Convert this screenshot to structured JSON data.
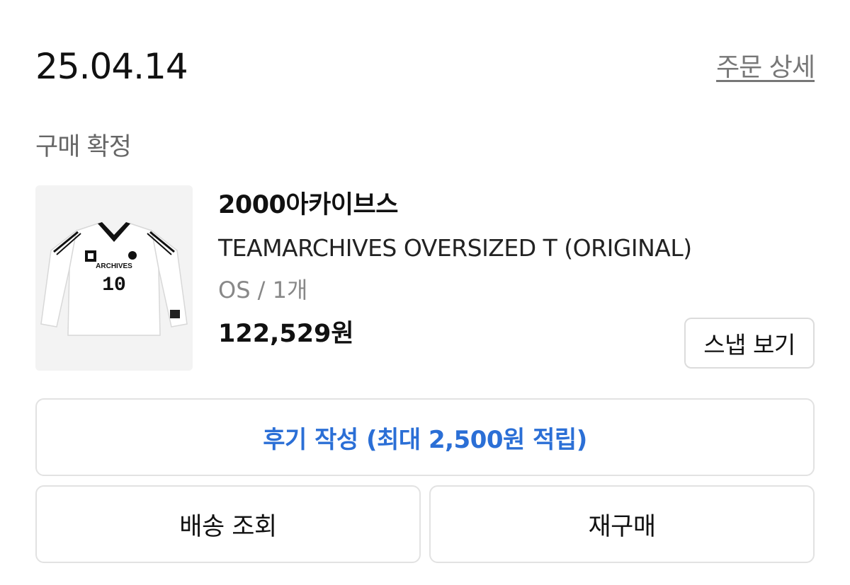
{
  "order": {
    "date": "25.04.14",
    "detail_link": "주문 상세",
    "status": "구매 확정"
  },
  "product": {
    "brand": "2000아카이브스",
    "name": "TEAMARCHIVES OVERSIZED T (ORIGINAL)",
    "option": "OS / 1개",
    "price": "122,529원",
    "image_text": {
      "team": "ARCHIVES",
      "number": "10"
    }
  },
  "actions": {
    "snap": "스냅 보기",
    "review": "후기 작성 (최대 2,500원 적립)",
    "delivery": "배송 조회",
    "reorder": "재구매"
  },
  "colors": {
    "review_text": "#2b6fd6",
    "muted_text": "#777777",
    "border": "#e2e2e2"
  }
}
